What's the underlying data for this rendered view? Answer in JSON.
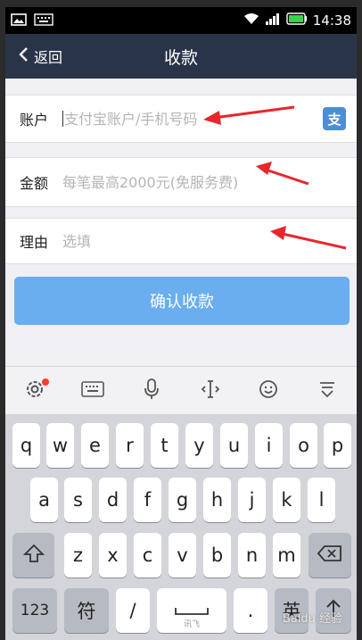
{
  "status_bar": {
    "time": "14:38",
    "icons": [
      "image-icon",
      "keyboard-icon",
      "wifi-icon",
      "signal-icon",
      "battery-icon"
    ]
  },
  "nav": {
    "back_label": "返回",
    "title": "收款"
  },
  "form": {
    "account": {
      "label": "账户",
      "placeholder": "支付宝账户/手机号码"
    },
    "amount": {
      "label": "金额",
      "placeholder": "每笔最高2000元(免服务费)"
    },
    "reason": {
      "label": "理由",
      "placeholder": "选填"
    },
    "alipay_icon": "支",
    "confirm_label": "确认收款"
  },
  "colors": {
    "nav_bg": "#2a3449",
    "confirm_bg": "#6aaef0",
    "arrow": "#e8262b"
  },
  "toolbar": {
    "icons": [
      "gear-icon",
      "keyboard-icon",
      "microphone-icon",
      "cursor-move-icon",
      "emoji-icon",
      "collapse-keyboard-icon"
    ]
  },
  "keyboard": {
    "row1": [
      "q",
      "w",
      "e",
      "r",
      "t",
      "y",
      "u",
      "i",
      "o",
      "p"
    ],
    "row2": [
      "a",
      "s",
      "d",
      "f",
      "g",
      "h",
      "j",
      "k",
      "l"
    ],
    "row3": [
      "z",
      "x",
      "c",
      "v",
      "b",
      "n",
      "m"
    ],
    "num_label": "123",
    "symbol_label": "符",
    "slash_label": "/",
    "space_sub": "讯飞",
    "dot_label": ".",
    "en_label": "英"
  },
  "watermark": "Baidu 经验"
}
